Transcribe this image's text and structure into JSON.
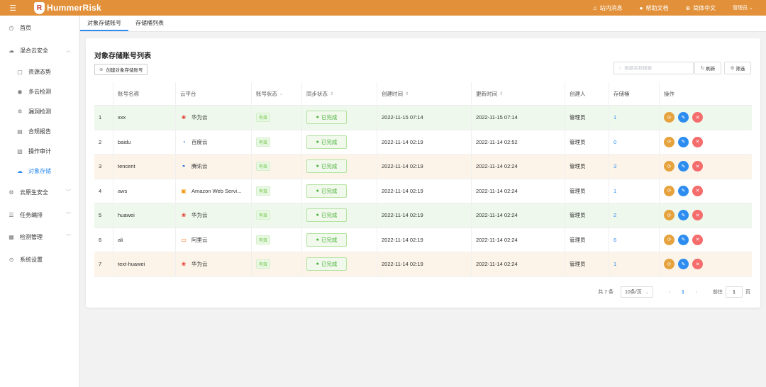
{
  "topbar": {
    "menu_icon": "hamburger-icon",
    "logo_text": "HummerRisk",
    "messages": "站内消息",
    "help": "帮助文档",
    "language": "简体中文",
    "user": "管理员",
    "brand_color": "#e2913a"
  },
  "sidebar": {
    "items": [
      {
        "label": "首页",
        "icon": "clock-icon"
      },
      {
        "label": "混合云安全",
        "icon": "cloud-icon"
      },
      {
        "label": "资源态势",
        "icon": "monitor-icon"
      },
      {
        "label": "多云检测",
        "icon": "eye-icon"
      },
      {
        "label": "漏洞检测",
        "icon": "bug-icon"
      },
      {
        "label": "合规报告",
        "icon": "report-icon"
      },
      {
        "label": "操作审计",
        "icon": "audit-icon"
      },
      {
        "label": "对象存储",
        "icon": "storage-icon"
      },
      {
        "label": "云原生安全",
        "icon": "cloud-native-icon"
      },
      {
        "label": "任务编排",
        "icon": "list-icon"
      },
      {
        "label": "检测管理",
        "icon": "grid-icon"
      },
      {
        "label": "系统设置",
        "icon": "settings-icon"
      }
    ]
  },
  "tabs": [
    {
      "label": "对象存储账号"
    },
    {
      "label": "存储桶列表"
    }
  ],
  "main": {
    "title": "对象存储账号列表",
    "create_button": "创建对象存储账号",
    "search_placeholder": "根据名称搜索",
    "refresh": "刷新",
    "filter": "筛选"
  },
  "table": {
    "columns": [
      "账号名称",
      "云平台",
      "账号状态",
      "同步状态",
      "创建时间",
      "更新时间",
      "创建人",
      "存储桶",
      "操作"
    ],
    "rows": [
      {
        "idx": "1",
        "name": "xxx",
        "platform": "华为云",
        "platform_icon": "huawei-icon",
        "status": "有效",
        "sync": "已完成",
        "created": "2022-11-15 07:14",
        "updated": "2022-11-15 07:14",
        "creator": "管理员",
        "buckets": "1"
      },
      {
        "idx": "2",
        "name": "baidu",
        "platform": "百度云",
        "platform_icon": "baidu-icon",
        "status": "有效",
        "sync": "已完成",
        "created": "2022-11-14 02:19",
        "updated": "2022-11-14 02:52",
        "creator": "管理员",
        "buckets": "0"
      },
      {
        "idx": "3",
        "name": "tencent",
        "platform": "腾讯云",
        "platform_icon": "tencent-icon",
        "status": "有效",
        "sync": "已完成",
        "created": "2022-11-14 02:19",
        "updated": "2022-11-14 02:24",
        "creator": "管理员",
        "buckets": "3"
      },
      {
        "idx": "4",
        "name": "aws",
        "platform": "Amazon Web Servi...",
        "platform_icon": "aws-icon",
        "status": "有效",
        "sync": "已完成",
        "created": "2022-11-14 02:19",
        "updated": "2022-11-14 02:24",
        "creator": "管理员",
        "buckets": "1"
      },
      {
        "idx": "5",
        "name": "huawei",
        "platform": "华为云",
        "platform_icon": "huawei-icon",
        "status": "有效",
        "sync": "已完成",
        "created": "2022-11-14 02:19",
        "updated": "2022-11-14 02:24",
        "creator": "管理员",
        "buckets": "2"
      },
      {
        "idx": "6",
        "name": "ali",
        "platform": "阿里云",
        "platform_icon": "aliyun-icon",
        "status": "有效",
        "sync": "已完成",
        "created": "2022-11-14 02:19",
        "updated": "2022-11-14 02:24",
        "creator": "管理员",
        "buckets": "6"
      },
      {
        "idx": "7",
        "name": "text-huawei",
        "platform": "华为云",
        "platform_icon": "huawei-icon",
        "status": "有效",
        "sync": "已完成",
        "created": "2022-11-14 02:19",
        "updated": "2022-11-14 02:24",
        "creator": "管理员",
        "buckets": "1"
      }
    ]
  },
  "pagination": {
    "total": "共 7 条",
    "page_size": "10条/页",
    "current": "1",
    "goto_label": "前往",
    "goto_value": "1",
    "page_unit": "页"
  }
}
